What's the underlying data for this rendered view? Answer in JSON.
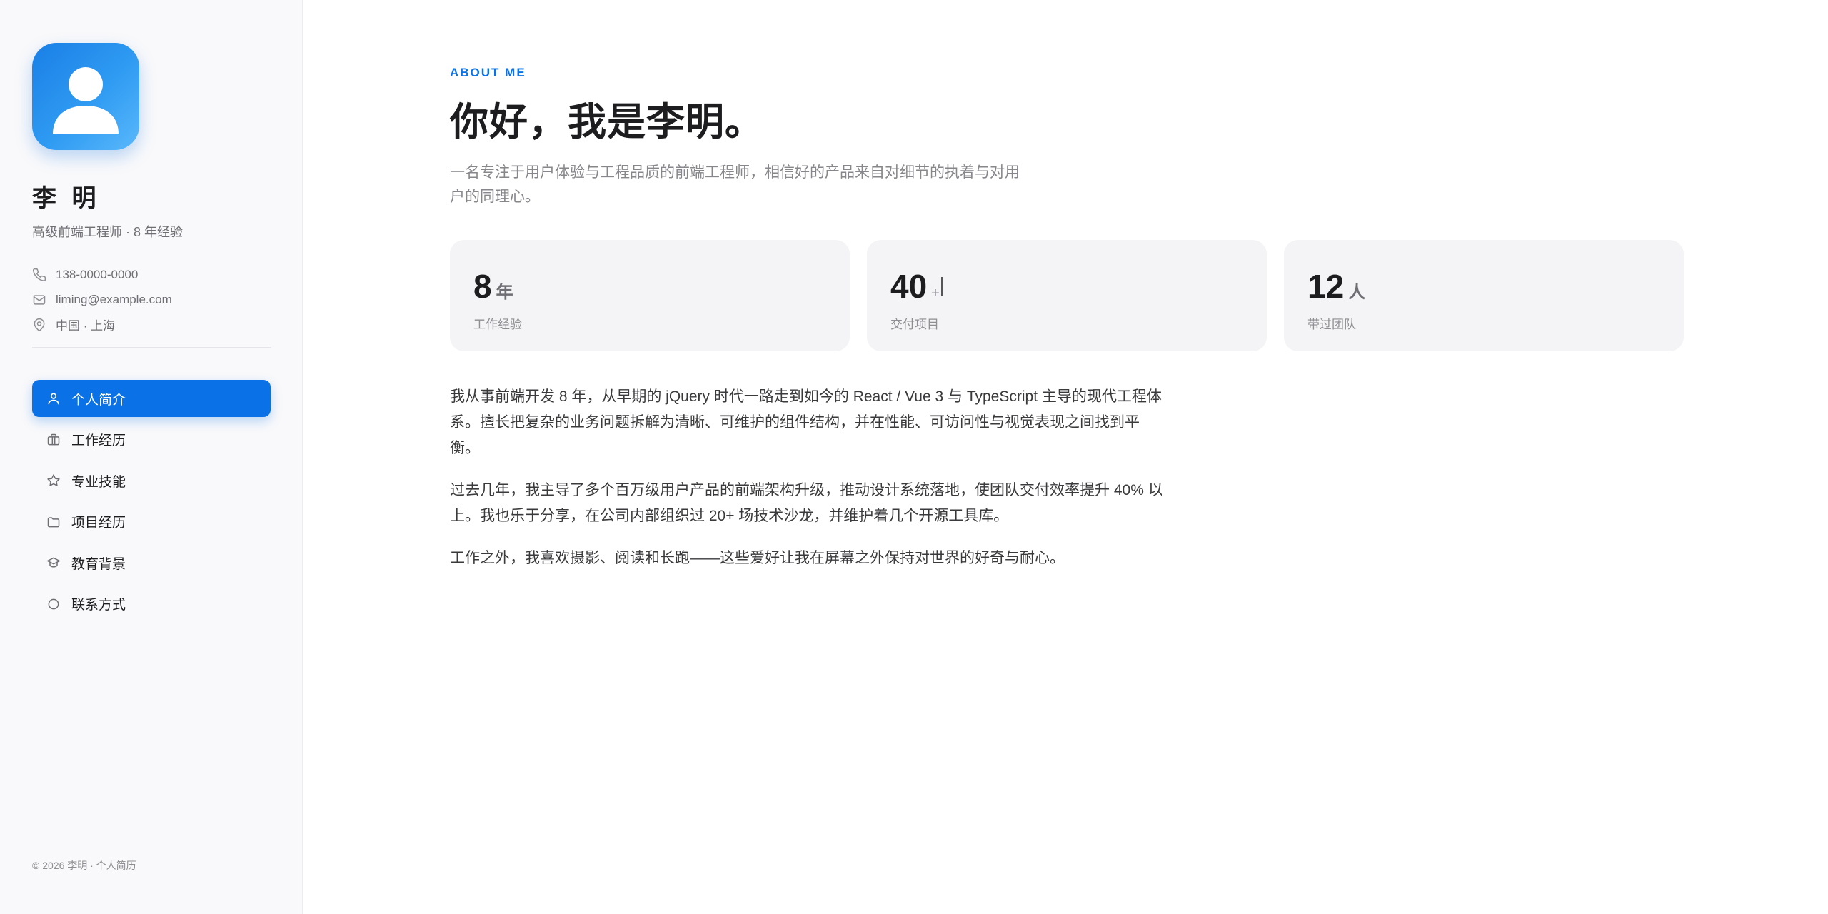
{
  "sidebar": {
    "name": "李 明",
    "title": "高级前端工程师 · 8 年经验",
    "contacts": {
      "phone": "138-0000-0000",
      "email": "liming@example.com",
      "location": "中国 · 上海"
    },
    "nav": [
      {
        "label": "个人简介",
        "icon": "user-icon",
        "active": true
      },
      {
        "label": "工作经历",
        "icon": "briefcase-icon",
        "active": false
      },
      {
        "label": "专业技能",
        "icon": "star-icon",
        "active": false
      },
      {
        "label": "项目经历",
        "icon": "folder-icon",
        "active": false
      },
      {
        "label": "教育背景",
        "icon": "graduation-cap-icon",
        "active": false
      },
      {
        "label": "联系方式",
        "icon": "circle-icon",
        "active": false
      }
    ],
    "footer": "© 2026 李明 · 个人简历"
  },
  "main": {
    "eyebrow": "ABOUT ME",
    "headline": "你好，我是李明。",
    "intro": "一名专注于用户体验与工程品质的前端工程师，相信好的产品来自对细节的执着与对用户的同理心。",
    "stats": [
      {
        "value": "8",
        "unit": "年",
        "label": "工作经验"
      },
      {
        "value": "40",
        "unit": "+",
        "label": "交付项目"
      },
      {
        "value": "12",
        "unit": "人",
        "label": "带过团队"
      }
    ],
    "paragraphs": [
      "我从事前端开发 8 年，从早期的 jQuery 时代一路走到如今的 React / Vue 3 与 TypeScript 主导的现代工程体系。擅长把复杂的业务问题拆解为清晰、可维护的组件结构，并在性能、可访问性与视觉表现之间找到平衡。",
      "过去几年，我主导了多个百万级用户产品的前端架构升级，推动设计系统落地，使团队交付效率提升 40% 以上。我也乐于分享，在公司内部组织过 20+ 场技术沙龙，并维护着几个开源工具库。",
      "工作之外，我喜欢摄影、阅读和长跑——这些爱好让我在屏幕之外保持对世界的好奇与耐心。"
    ]
  },
  "colors": {
    "accent": "#0a72e6",
    "sidebar_bg": "#f9f9fb",
    "card_bg": "#f4f4f6"
  }
}
